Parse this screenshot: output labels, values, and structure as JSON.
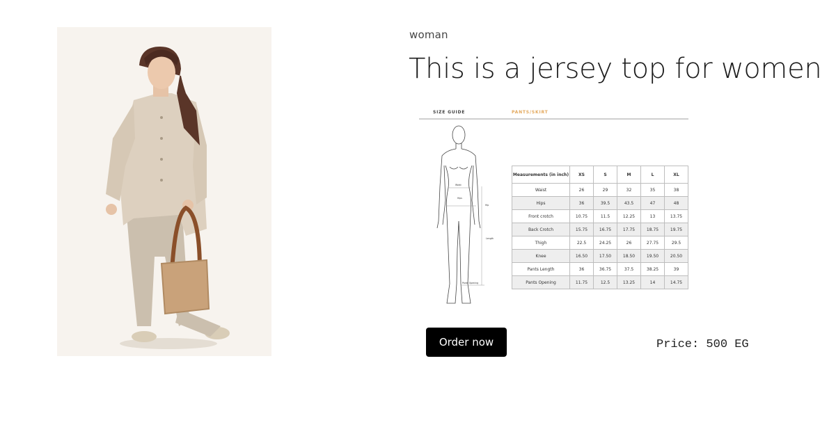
{
  "product": {
    "category": "woman",
    "title": "This is a jersey top for women.",
    "image_icon": "product-photo",
    "order_label": "Order now",
    "price_text": "Price: 500 EG"
  },
  "size_guide": {
    "header": "SIZE GUIDE",
    "subheader": "PANTS/SKIRT",
    "accent_color": "#e3a85c",
    "figure_labels": {
      "waist": "Waist",
      "hips": "Hips",
      "hip": "Hip",
      "length": "Length",
      "opening": "Pants Opening"
    },
    "columns": [
      "Measurements (in inch)",
      "XS",
      "S",
      "M",
      "L",
      "XL"
    ],
    "rows": [
      [
        "Waist",
        "26",
        "29",
        "32",
        "35",
        "38"
      ],
      [
        "Hips",
        "36",
        "39.5",
        "43.5",
        "47",
        "48"
      ],
      [
        "Front crotch",
        "10.75",
        "11.5",
        "12.25",
        "13",
        "13.75"
      ],
      [
        "Back Crotch",
        "15.75",
        "16.75",
        "17.75",
        "18.75",
        "19.75"
      ],
      [
        "Thigh",
        "22.5",
        "24.25",
        "26",
        "27.75",
        "29.5"
      ],
      [
        "Knee",
        "16.50",
        "17.50",
        "18.50",
        "19.50",
        "20.50"
      ],
      [
        "Pants Length",
        "36",
        "36.75",
        "37.5",
        "38.25",
        "39"
      ],
      [
        "Pants Opening",
        "11.75",
        "12.5",
        "13.25",
        "14",
        "14.75"
      ]
    ]
  },
  "colors": {
    "button_bg": "#000000",
    "button_text": "#ffffff",
    "photo_bg": "#f7f3ee"
  }
}
